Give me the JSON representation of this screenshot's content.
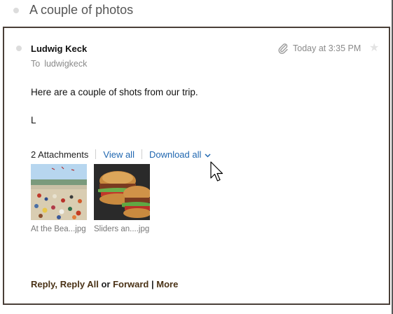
{
  "subject": "A couple of photos",
  "message": {
    "sender": "Ludwig Keck",
    "to_label": "To",
    "recipient": "ludwigkeck",
    "timestamp": "Today at 3:35 PM",
    "body_line1": "Here are a couple of shots from our trip.",
    "body_line2": "L"
  },
  "attachments": {
    "count_label": "2 Attachments",
    "view_all": "View all",
    "download_all": "Download all",
    "items": [
      {
        "name": "At the Bea...jpg"
      },
      {
        "name": "Sliders an....jpg"
      }
    ]
  },
  "actions": {
    "reply": "Reply,",
    "reply_all": "Reply All",
    "or": "or",
    "forward": "Forward",
    "divider": "|",
    "more": "More"
  },
  "icons": {
    "attachment": "paperclip-icon",
    "flag": "star-icon",
    "dropdown": "chevron-down-icon"
  },
  "colors": {
    "link": "#2067b0",
    "action": "#4a3216",
    "card_border": "#4a3f38"
  }
}
